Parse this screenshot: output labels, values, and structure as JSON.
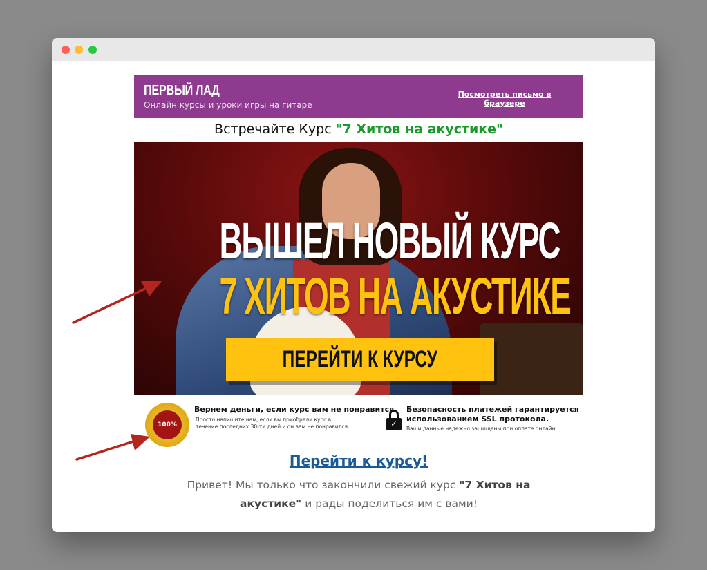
{
  "header": {
    "brand": "ПЕРВЫЙ ЛАД",
    "tagline": "Онлайн курсы и уроки игры на гитаре",
    "view_in_browser": "Посмотреть письмо в браузере"
  },
  "intro_heading": {
    "prefix": "Встречайте Курс ",
    "course_name": "\"7 Хитов на акустике\""
  },
  "hero": {
    "headline_1": "ВЫШЕЛ НОВЫЙ КУРС",
    "headline_2": "7 ХИТОВ НА АКУСТИКЕ",
    "cta": "ПЕРЕЙТИ К КУРСУ"
  },
  "guarantees": {
    "badge_text": "100%",
    "money_back_title": "Вернем деньги, если курс вам не понравится",
    "money_back_text": "Просто напишите нам, если вы приобрели курс в течение последних 30-ти дней и он вам не понравился",
    "security_title": "Безопасность платежей гарантируется использованием SSL протокола.",
    "security_text": "Ваши данные надежно защищены при оплате онлайн"
  },
  "course_link": "Перейти к курсу!",
  "body": {
    "part1": "Привет! Мы только что закончили свежий курс ",
    "bold": "\"7 Хитов на акустике\"",
    "part2": " и рады поделиться им с вами!"
  },
  "colors": {
    "header_bg": "#8e3b8f",
    "accent_green": "#1a9a2a",
    "cta_yellow": "#ffc20e",
    "link_blue": "#1a5a96",
    "arrow_red": "#b3261e"
  }
}
